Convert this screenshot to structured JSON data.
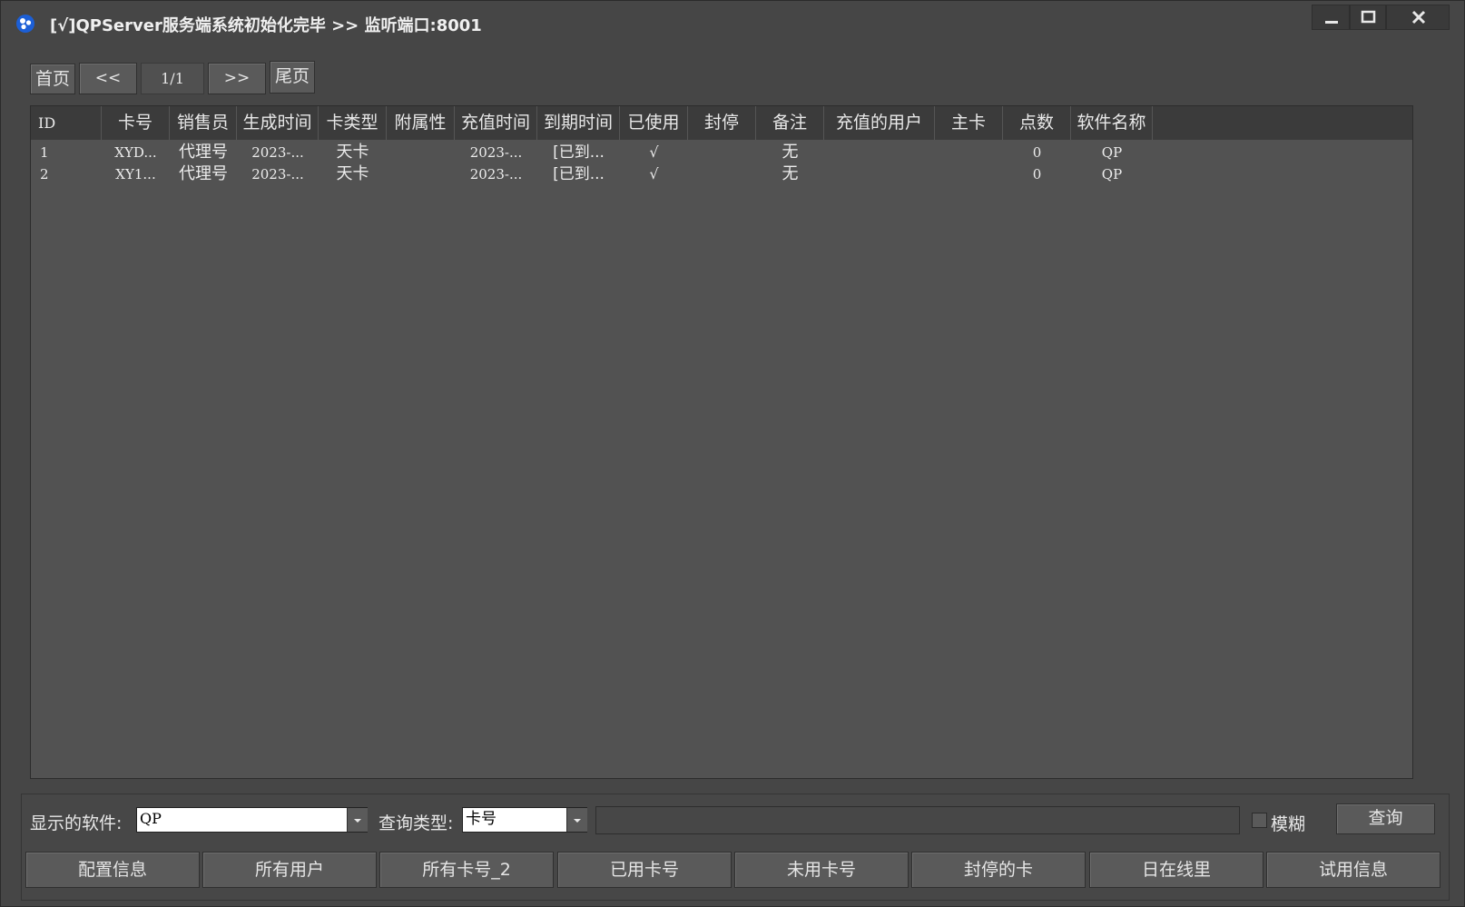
{
  "window": {
    "title": "[√]QPServer服务端系统初始化完毕 >> 监听端口:8001",
    "icon": "app-logo-icon",
    "controls": [
      "minimize-icon",
      "maximize-icon",
      "close-icon"
    ]
  },
  "pager": {
    "first": "首页",
    "prev": "<<",
    "page": "1/1",
    "next": ">>",
    "last": "尾页"
  },
  "table": {
    "columns": [
      "ID",
      "卡号",
      "销售员",
      "生成时间",
      "卡类型",
      "附属性",
      "充值时间",
      "到期时间",
      "已使用",
      "封停",
      "备注",
      "充值的用户",
      "主卡",
      "点数",
      "软件名称"
    ],
    "rows": [
      [
        "1",
        "XYD...",
        "代理号",
        "2023-...",
        "天卡",
        "",
        "2023-...",
        "[已到...",
        "√",
        "",
        "无",
        "",
        "",
        "0",
        "QP"
      ],
      [
        "2",
        "XY1...",
        "代理号",
        "2023-...",
        "天卡",
        "",
        "2023-...",
        "[已到...",
        "√",
        "",
        "无",
        "",
        "",
        "0",
        "QP"
      ]
    ]
  },
  "filter": {
    "software_label": "显示的软件:",
    "software_value": "QP",
    "query_type_label": "查询类型:",
    "query_type_value": "卡号",
    "search_value": "",
    "fuzzy_label": "模糊",
    "query_button": "查询"
  },
  "bottom_buttons": [
    "配置信息",
    "所有用户",
    "所有卡号_2",
    "已用卡号",
    "未用卡号",
    "封停的卡",
    "日在线里",
    "试用信息"
  ],
  "colors": {
    "window_bg": "#464646",
    "grid_bg": "#525252",
    "header_bg": "#3b3b3b",
    "text": "#e6e6e6"
  }
}
